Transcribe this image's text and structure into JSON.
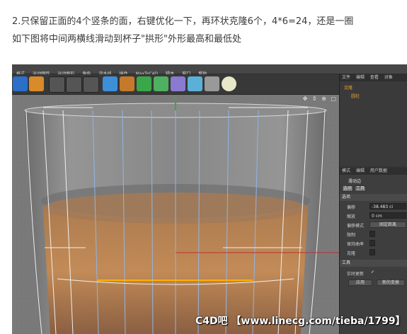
{
  "article": {
    "caption_line1": "2.只保留正面的4个竖条的面，右键优化一下，再环状克隆6个，4*6=24，还是一圈",
    "caption_line2": "如下图将中间两横线滑动到杯子\"拱形\"外形最高和最低处"
  },
  "app": {
    "menu": [
      "格式",
      "运动跟踪",
      "运动图形",
      "角色",
      "流水线",
      "插件",
      "MaxToC4D",
      "脚本",
      "窗口",
      "帮助"
    ],
    "viewport": {
      "nav_icons": "✥ ⇕ ⊕ ▢",
      "axis_label": "Y"
    },
    "object_manager": {
      "tabs": [
        "文件",
        "编辑",
        "查看",
        "对象"
      ],
      "objects": [
        "克隆",
        "圆柱"
      ]
    },
    "attribute_manager": {
      "tabs": [
        "模式",
        "编辑",
        "用户数据"
      ],
      "tool_name": "滑动边",
      "subtabs": [
        "选项",
        "工具"
      ],
      "options_section": "选项",
      "offset_label": "偏移",
      "offset_value": "-38.483 ci",
      "scale_label": "缩放",
      "scale_value": "0 cm",
      "offset_mode_label": "偏移模式",
      "offset_mode_value": "固定距离",
      "limit_label": "限制",
      "keep_curvature_label": "保持曲率",
      "clone_label": "克隆",
      "tool_section": "工具",
      "realtime_label": "实时更新",
      "realtime_check": "✓",
      "apply_button": "应用",
      "new_transform_button": "新的变换"
    },
    "colors": {
      "accent_orange": "#e8a030",
      "selected_edge": "#ffb000",
      "viewport_bg": "#7a7a7a",
      "edge_blue": "#8fb6e8"
    }
  },
  "watermark": "C4D吧 【www.linecg.com/tieba/1799】"
}
